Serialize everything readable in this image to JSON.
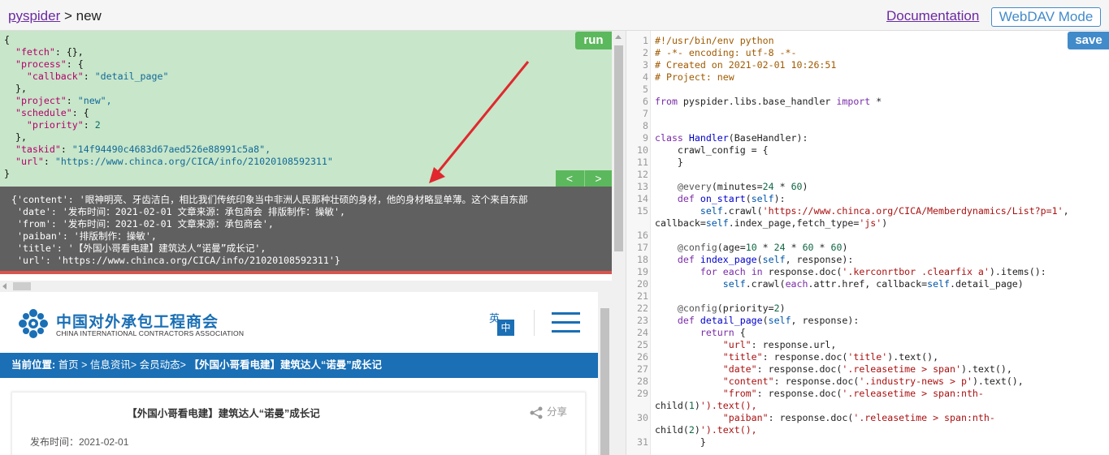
{
  "header": {
    "project_link": "pyspider",
    "separator": " > ",
    "project_name": "new",
    "documentation_label": "Documentation",
    "webdav_label": "WebDAV Mode"
  },
  "debug": {
    "run_label": "run",
    "prev_label": "<",
    "next_label": ">",
    "request_lines": [
      "{",
      "  \"fetch\": {},",
      "  \"process\": {",
      "    \"callback\": \"detail_page\"",
      "  },",
      "  \"project\": \"new\",",
      "  \"schedule\": {",
      "    \"priority\": 2",
      "  },",
      "  \"taskid\": \"14f94490c4683d67aed526e88991c5a8\",",
      "  \"url\": \"https://www.chinca.org/CICA/info/21020108592311\"",
      "}"
    ],
    "result_lines": [
      "{'content': '眼神明亮、牙齿洁白，相比我们传统印象当中非洲人民那种壮硕的身材，他的身材略显单薄。这个来自东部",
      " 'date': '发布时间：2021-02-01 文章来源：承包商会 排版制作：操敏',",
      " 'from': '发布时间：2021-02-01 文章来源：承包商会',",
      " 'paiban': '排版制作：操敏',",
      " 'title': '【外国小哥看电建】建筑达人“诺曼”成长记',",
      " 'url': 'https://www.chinca.org/CICA/info/21020108592311'}"
    ]
  },
  "preview": {
    "logo_cn": "中国对外承包工程商会",
    "logo_en": "CHINA INTERNATIONAL CONTRACTORS ASSOCIATION",
    "lang_en": "英",
    "lang_cn": "中",
    "breadcrumb_prefix": "当前位置:",
    "breadcrumb_path": " 首页 > 信息资讯> 会员动态> ",
    "breadcrumb_current": "【外国小哥看电建】建筑达人“诺曼”成长记",
    "article_title": "【外国小哥看电建】建筑达人“诺曼”成长记",
    "share_label": "分享",
    "pubdate": "发布时间：2021-02-01"
  },
  "editor": {
    "save_label": "save",
    "line_numbers": [
      "1",
      "2",
      "3",
      "4",
      "5",
      "6",
      "7",
      "8",
      "9",
      "10",
      "11",
      "12",
      "13",
      "14",
      "15",
      "",
      "16",
      "17",
      "18",
      "19",
      "20",
      "21",
      "22",
      "23",
      "24",
      "25",
      "26",
      "27",
      "28",
      "29",
      "",
      "30",
      "",
      "31"
    ],
    "code_lines": [
      "#!/usr/bin/env python",
      "# -*- encoding: utf-8 -*-",
      "# Created on 2021-02-01 10:26:51",
      "# Project: new",
      "",
      "from pyspider.libs.base_handler import *",
      "",
      "",
      "class Handler(BaseHandler):",
      "    crawl_config = {",
      "    }",
      "",
      "    @every(minutes=24 * 60)",
      "    def on_start(self):",
      "        self.crawl('https://www.chinca.org/CICA/Memberdynamics/List?p=1',",
      "callback=self.index_page,fetch_type='js')",
      "",
      "    @config(age=10 * 24 * 60 * 60)",
      "    def index_page(self, response):",
      "        for each in response.doc('.kerconrtbor .clearfix a').items():",
      "            self.crawl(each.attr.href, callback=self.detail_page)",
      "",
      "    @config(priority=2)",
      "    def detail_page(self, response):",
      "        return {",
      "            \"url\": response.url,",
      "            \"title\": response.doc('title').text(),",
      "            \"date\": response.doc('.releasetime > span').text(),",
      "            \"content\": response.doc('.industry-news > p').text(),",
      "            \"from\": response.doc('.releasetime > span:nth-",
      "child(1)').text(),",
      "            \"paiban\": response.doc('.releasetime > span:nth-",
      "child(2)').text(),",
      "        }"
    ]
  },
  "colors": {
    "request_bg": "#c8e6c9",
    "result_bg": "#606060",
    "accent_green": "#5cb85c",
    "accent_blue": "#428bca",
    "site_blue": "#1a6fb5",
    "annotation_arrow": "#e0282e"
  }
}
